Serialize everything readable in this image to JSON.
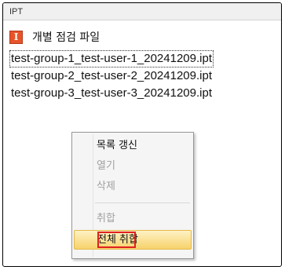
{
  "window": {
    "title": "IPT"
  },
  "group": {
    "icon": "ipt-file-type-icon",
    "icon_glyph": "I",
    "label": "개별 점검 파일"
  },
  "files": [
    "test-group-1_test-user-1_20241209.ipt",
    "test-group-2_test-user-2_20241209.ipt",
    "test-group-3_test-user-3_20241209.ipt"
  ],
  "context_menu": {
    "refresh": "목록 갱신",
    "open": "열기",
    "delete": "삭제",
    "cancel": "취합",
    "cancel_all": "전체 취합"
  },
  "colors": {
    "highlight": "#e02020",
    "hover": "#f7d26c",
    "icon": "#e8542a"
  }
}
